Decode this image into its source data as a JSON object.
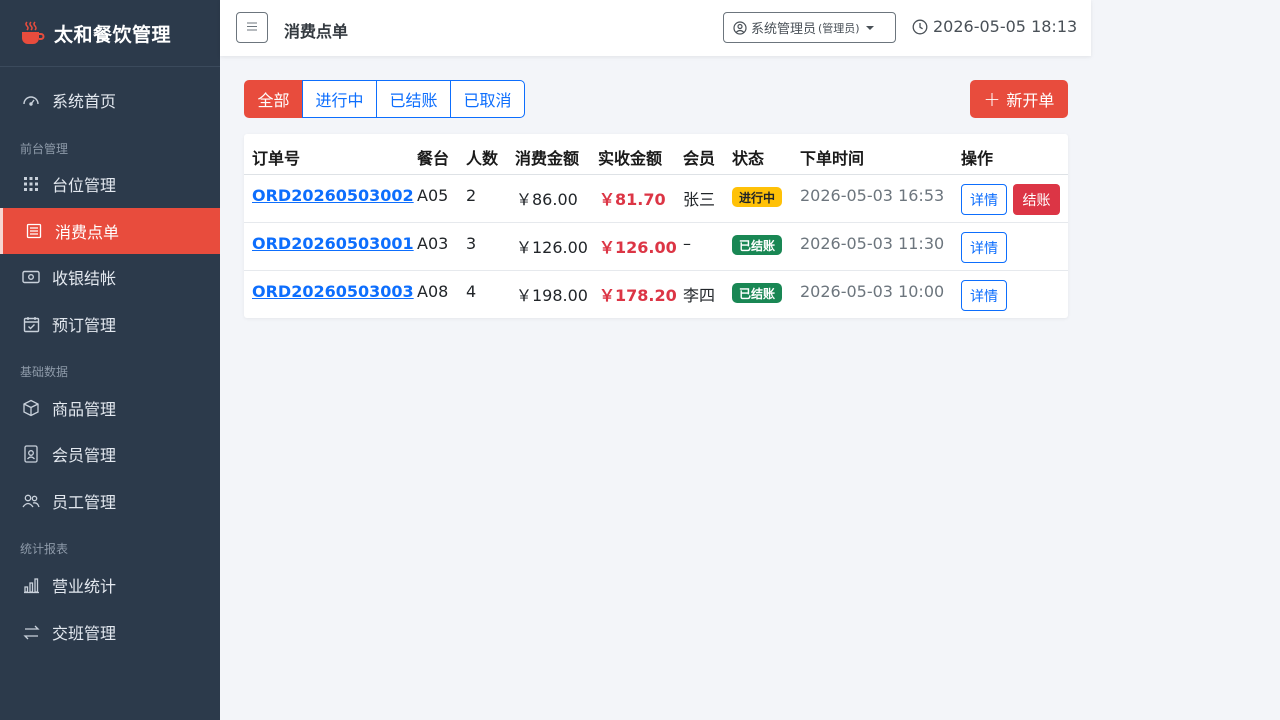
{
  "brand": {
    "title": "太和餐饮管理",
    "icon": "coffee-cup-icon",
    "icon_color": "#e84c3d"
  },
  "sidebar": {
    "items": [
      {
        "label": "系统首页",
        "icon": "dashboard-gauge-icon"
      },
      {
        "label": "台位管理",
        "icon": "grid-icon"
      },
      {
        "label": "消费点单",
        "icon": "receipt-list-icon",
        "active": true
      },
      {
        "label": "收银结帐",
        "icon": "cash-icon"
      },
      {
        "label": "预订管理",
        "icon": "calendar-check-icon"
      },
      {
        "label": "商品管理",
        "icon": "box-icon"
      },
      {
        "label": "会员管理",
        "icon": "member-card-icon"
      },
      {
        "label": "员工管理",
        "icon": "people-icon"
      },
      {
        "label": "营业统计",
        "icon": "bar-chart-icon"
      },
      {
        "label": "交班管理",
        "icon": "swap-arrows-icon"
      }
    ],
    "sections": [
      "前台管理",
      "基础数据",
      "统计报表"
    ]
  },
  "topbar": {
    "menu_icon": "menu-icon",
    "title": "消费点单",
    "user_name": "系统管理员",
    "user_role": "(管理员)",
    "datetime": "2026-05-05 18:13"
  },
  "filters": [
    "全部",
    "进行中",
    "已结账",
    "已取消"
  ],
  "active_filter": "全部",
  "new_order_label": "新开单",
  "table": {
    "columns": [
      "订单号",
      "餐台",
      "人数",
      "消费金额",
      "实收金额",
      "会员",
      "状态",
      "下单时间",
      "操作"
    ],
    "rows": [
      {
        "order_no": "ORD20260503002",
        "table": "A05",
        "people": "2",
        "amount": "￥86.00",
        "paid": "￥81.70",
        "member": "张三",
        "status": "进行中",
        "status_type": "warning",
        "time": "2026-05-03 16:53",
        "detail": "详情",
        "checkout": "结账"
      },
      {
        "order_no": "ORD20260503001",
        "table": "A03",
        "people": "3",
        "amount": "￥126.00",
        "paid": "￥126.00",
        "member": "–",
        "status": "已结账",
        "status_type": "success",
        "time": "2026-05-03 11:30",
        "detail": "详情"
      },
      {
        "order_no": "ORD20260503003",
        "table": "A08",
        "people": "4",
        "amount": "￥198.00",
        "paid": "￥178.20",
        "member": "李四",
        "status": "已结账",
        "status_type": "success",
        "time": "2026-05-03 10:00",
        "detail": "详情"
      }
    ]
  },
  "colors": {
    "sidebar_bg": "#2c3a4b",
    "accent": "#e84c3d",
    "primary": "#0d6efd",
    "danger": "#dc3545",
    "warning": "#ffc107",
    "success": "#198754"
  }
}
